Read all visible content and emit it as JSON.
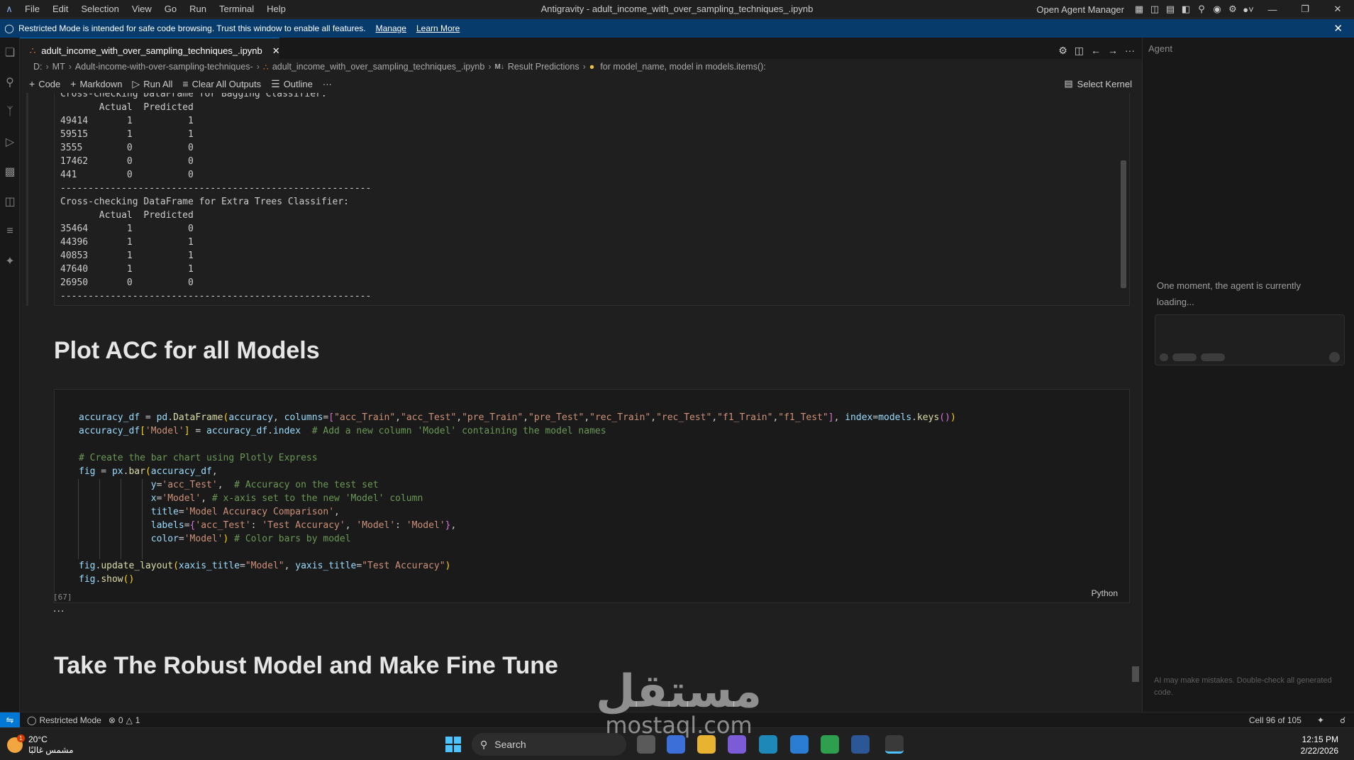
{
  "titlebar": {
    "menu": [
      "File",
      "Edit",
      "Selection",
      "View",
      "Go",
      "Run",
      "Terminal",
      "Help"
    ],
    "window_title": "Antigravity - adult_income_with_over_sampling_techniques_.ipynb",
    "agent_manager": "Open Agent Manager"
  },
  "banner": {
    "message": "Restricted Mode is intended for safe code browsing. Trust this window to enable all features.",
    "manage": "Manage",
    "learn_more": "Learn More"
  },
  "tab": {
    "label": "adult_income_with_over_sampling_techniques_.ipynb"
  },
  "breadcrumb": [
    "D:",
    "MT",
    "Adult-income-with-over-sampling-techniques-",
    "adult_income_with_over_sampling_techniques_.ipynb",
    "Result Predictions",
    "for model_name, model in models.items():"
  ],
  "toolbar": {
    "code": "Code",
    "markdown": "Markdown",
    "run_all": "Run All",
    "clear_outputs": "Clear All Outputs",
    "outline": "Outline",
    "more": "···",
    "kernel": "Select Kernel"
  },
  "output_text": "Cross-checking DataFrame for Bagging Classifier:\n       Actual  Predicted\n49414       1          1\n59515       1          1\n3555        0          0\n17462       0          0\n441         0          0\n--------------------------------------------------------\nCross-checking DataFrame for Extra Trees Classifier:\n       Actual  Predicted\n35464       1          0\n44396       1          1\n40853       1          1\n47640       1          1\n26950       0          0\n--------------------------------------------------------",
  "headings": {
    "plot": "Plot ACC for all Models",
    "finetune": "Take The Robust Model and Make Fine Tune"
  },
  "code_cell": {
    "exec_count": "[67]",
    "language": "Python",
    "more": "..."
  },
  "agent": {
    "header": "Agent",
    "loading": "One moment, the agent is currently loading...",
    "disclaimer": "AI may make mistakes. Double-check all generated code."
  },
  "status": {
    "restricted": "Restricted Mode",
    "errors": "0",
    "warnings": "1",
    "cell": "Cell 96 of 105"
  },
  "taskbar": {
    "temperature": "20°C",
    "weather_desc": "مشمس غالبًا",
    "weather_badge": "1",
    "search": "Search",
    "time": "12:15 PM",
    "date": "2/22/2026"
  },
  "watermark": {
    "arabic": "مستقل",
    "latin": "mostaql.com"
  },
  "colors": {
    "accent": "#0078d4",
    "banner": "#063b6b",
    "string": "#ce9178",
    "comment": "#6a9955",
    "variable": "#9cdcfe"
  }
}
